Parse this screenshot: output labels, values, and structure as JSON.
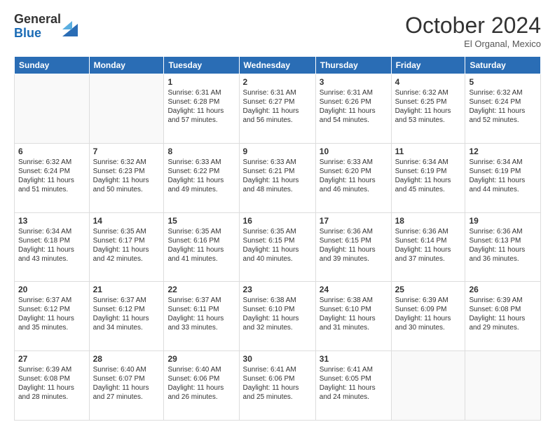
{
  "logo": {
    "general": "General",
    "blue": "Blue"
  },
  "title": "October 2024",
  "location": "El Organal, Mexico",
  "days_of_week": [
    "Sunday",
    "Monday",
    "Tuesday",
    "Wednesday",
    "Thursday",
    "Friday",
    "Saturday"
  ],
  "weeks": [
    [
      {
        "day": "",
        "empty": true
      },
      {
        "day": "",
        "empty": true
      },
      {
        "day": "1",
        "sunrise": "Sunrise: 6:31 AM",
        "sunset": "Sunset: 6:28 PM",
        "daylight": "Daylight: 11 hours and 57 minutes."
      },
      {
        "day": "2",
        "sunrise": "Sunrise: 6:31 AM",
        "sunset": "Sunset: 6:27 PM",
        "daylight": "Daylight: 11 hours and 56 minutes."
      },
      {
        "day": "3",
        "sunrise": "Sunrise: 6:31 AM",
        "sunset": "Sunset: 6:26 PM",
        "daylight": "Daylight: 11 hours and 54 minutes."
      },
      {
        "day": "4",
        "sunrise": "Sunrise: 6:32 AM",
        "sunset": "Sunset: 6:25 PM",
        "daylight": "Daylight: 11 hours and 53 minutes."
      },
      {
        "day": "5",
        "sunrise": "Sunrise: 6:32 AM",
        "sunset": "Sunset: 6:24 PM",
        "daylight": "Daylight: 11 hours and 52 minutes."
      }
    ],
    [
      {
        "day": "6",
        "sunrise": "Sunrise: 6:32 AM",
        "sunset": "Sunset: 6:24 PM",
        "daylight": "Daylight: 11 hours and 51 minutes."
      },
      {
        "day": "7",
        "sunrise": "Sunrise: 6:32 AM",
        "sunset": "Sunset: 6:23 PM",
        "daylight": "Daylight: 11 hours and 50 minutes."
      },
      {
        "day": "8",
        "sunrise": "Sunrise: 6:33 AM",
        "sunset": "Sunset: 6:22 PM",
        "daylight": "Daylight: 11 hours and 49 minutes."
      },
      {
        "day": "9",
        "sunrise": "Sunrise: 6:33 AM",
        "sunset": "Sunset: 6:21 PM",
        "daylight": "Daylight: 11 hours and 48 minutes."
      },
      {
        "day": "10",
        "sunrise": "Sunrise: 6:33 AM",
        "sunset": "Sunset: 6:20 PM",
        "daylight": "Daylight: 11 hours and 46 minutes."
      },
      {
        "day": "11",
        "sunrise": "Sunrise: 6:34 AM",
        "sunset": "Sunset: 6:19 PM",
        "daylight": "Daylight: 11 hours and 45 minutes."
      },
      {
        "day": "12",
        "sunrise": "Sunrise: 6:34 AM",
        "sunset": "Sunset: 6:19 PM",
        "daylight": "Daylight: 11 hours and 44 minutes."
      }
    ],
    [
      {
        "day": "13",
        "sunrise": "Sunrise: 6:34 AM",
        "sunset": "Sunset: 6:18 PM",
        "daylight": "Daylight: 11 hours and 43 minutes."
      },
      {
        "day": "14",
        "sunrise": "Sunrise: 6:35 AM",
        "sunset": "Sunset: 6:17 PM",
        "daylight": "Daylight: 11 hours and 42 minutes."
      },
      {
        "day": "15",
        "sunrise": "Sunrise: 6:35 AM",
        "sunset": "Sunset: 6:16 PM",
        "daylight": "Daylight: 11 hours and 41 minutes."
      },
      {
        "day": "16",
        "sunrise": "Sunrise: 6:35 AM",
        "sunset": "Sunset: 6:15 PM",
        "daylight": "Daylight: 11 hours and 40 minutes."
      },
      {
        "day": "17",
        "sunrise": "Sunrise: 6:36 AM",
        "sunset": "Sunset: 6:15 PM",
        "daylight": "Daylight: 11 hours and 39 minutes."
      },
      {
        "day": "18",
        "sunrise": "Sunrise: 6:36 AM",
        "sunset": "Sunset: 6:14 PM",
        "daylight": "Daylight: 11 hours and 37 minutes."
      },
      {
        "day": "19",
        "sunrise": "Sunrise: 6:36 AM",
        "sunset": "Sunset: 6:13 PM",
        "daylight": "Daylight: 11 hours and 36 minutes."
      }
    ],
    [
      {
        "day": "20",
        "sunrise": "Sunrise: 6:37 AM",
        "sunset": "Sunset: 6:12 PM",
        "daylight": "Daylight: 11 hours and 35 minutes."
      },
      {
        "day": "21",
        "sunrise": "Sunrise: 6:37 AM",
        "sunset": "Sunset: 6:12 PM",
        "daylight": "Daylight: 11 hours and 34 minutes."
      },
      {
        "day": "22",
        "sunrise": "Sunrise: 6:37 AM",
        "sunset": "Sunset: 6:11 PM",
        "daylight": "Daylight: 11 hours and 33 minutes."
      },
      {
        "day": "23",
        "sunrise": "Sunrise: 6:38 AM",
        "sunset": "Sunset: 6:10 PM",
        "daylight": "Daylight: 11 hours and 32 minutes."
      },
      {
        "day": "24",
        "sunrise": "Sunrise: 6:38 AM",
        "sunset": "Sunset: 6:10 PM",
        "daylight": "Daylight: 11 hours and 31 minutes."
      },
      {
        "day": "25",
        "sunrise": "Sunrise: 6:39 AM",
        "sunset": "Sunset: 6:09 PM",
        "daylight": "Daylight: 11 hours and 30 minutes."
      },
      {
        "day": "26",
        "sunrise": "Sunrise: 6:39 AM",
        "sunset": "Sunset: 6:08 PM",
        "daylight": "Daylight: 11 hours and 29 minutes."
      }
    ],
    [
      {
        "day": "27",
        "sunrise": "Sunrise: 6:39 AM",
        "sunset": "Sunset: 6:08 PM",
        "daylight": "Daylight: 11 hours and 28 minutes."
      },
      {
        "day": "28",
        "sunrise": "Sunrise: 6:40 AM",
        "sunset": "Sunset: 6:07 PM",
        "daylight": "Daylight: 11 hours and 27 minutes."
      },
      {
        "day": "29",
        "sunrise": "Sunrise: 6:40 AM",
        "sunset": "Sunset: 6:06 PM",
        "daylight": "Daylight: 11 hours and 26 minutes."
      },
      {
        "day": "30",
        "sunrise": "Sunrise: 6:41 AM",
        "sunset": "Sunset: 6:06 PM",
        "daylight": "Daylight: 11 hours and 25 minutes."
      },
      {
        "day": "31",
        "sunrise": "Sunrise: 6:41 AM",
        "sunset": "Sunset: 6:05 PM",
        "daylight": "Daylight: 11 hours and 24 minutes."
      },
      {
        "day": "",
        "empty": true
      },
      {
        "day": "",
        "empty": true
      }
    ]
  ]
}
